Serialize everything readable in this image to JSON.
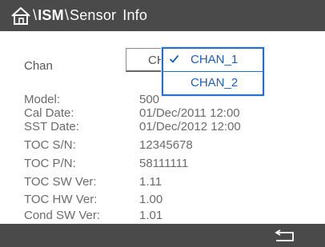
{
  "header": {
    "breadcrumb_sep_1": "\\",
    "breadcrumb_ism": "ISM",
    "breadcrumb_sep_2": "\\",
    "breadcrumb_sensor": "Sensor",
    "breadcrumb_info": "Info",
    "home_icon": "home-icon"
  },
  "chan": {
    "label": "Chan",
    "selected_value": "CH",
    "dropdown": {
      "options": [
        {
          "label": "CHAN_1",
          "checked": true
        },
        {
          "label": "CHAN_2",
          "checked": false
        }
      ]
    }
  },
  "info_rows": [
    {
      "label": "Model:",
      "value": "500"
    },
    {
      "label": "Cal Date:",
      "value": "01/Dec/2011 12:00"
    },
    {
      "label": "SST Date:",
      "value": "01/Dec/2012 12:00"
    },
    {
      "label": "TOC S/N:",
      "value": "12345678"
    },
    {
      "label": "TOC P/N:",
      "value": "58111111"
    },
    {
      "label": "TOC SW Ver:",
      "value": "1.11"
    },
    {
      "label": "TOC HW Ver:",
      "value": "1.00"
    },
    {
      "label": "Cond SW Ver:",
      "value": "1.01"
    }
  ],
  "footer": {
    "back_icon": "back-icon"
  },
  "colors": {
    "bar_bg": "#4a4a4a",
    "accent": "#1f6fd6",
    "text_gray": "#6b6b6b"
  }
}
